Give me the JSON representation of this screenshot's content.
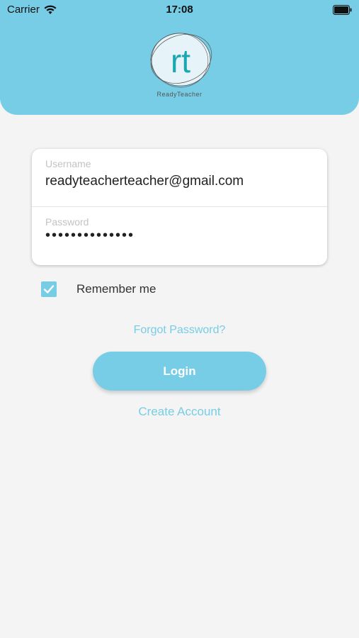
{
  "status_bar": {
    "carrier": "Carrier",
    "time": "17:08"
  },
  "logo": {
    "monogram": "rt",
    "caption": "ReadyTeacher"
  },
  "login_form": {
    "username_label": "Username",
    "username_value": "readyteacherteacher@gmail.com",
    "password_label": "Password",
    "password_value": "••••••••••••••"
  },
  "remember_me": {
    "label": "Remember me",
    "checked": true
  },
  "links": {
    "forgot_password": "Forgot Password?",
    "create_account": "Create Account"
  },
  "buttons": {
    "login": "Login"
  },
  "colors": {
    "accent": "#77cde5",
    "background": "#f4f4f4"
  }
}
